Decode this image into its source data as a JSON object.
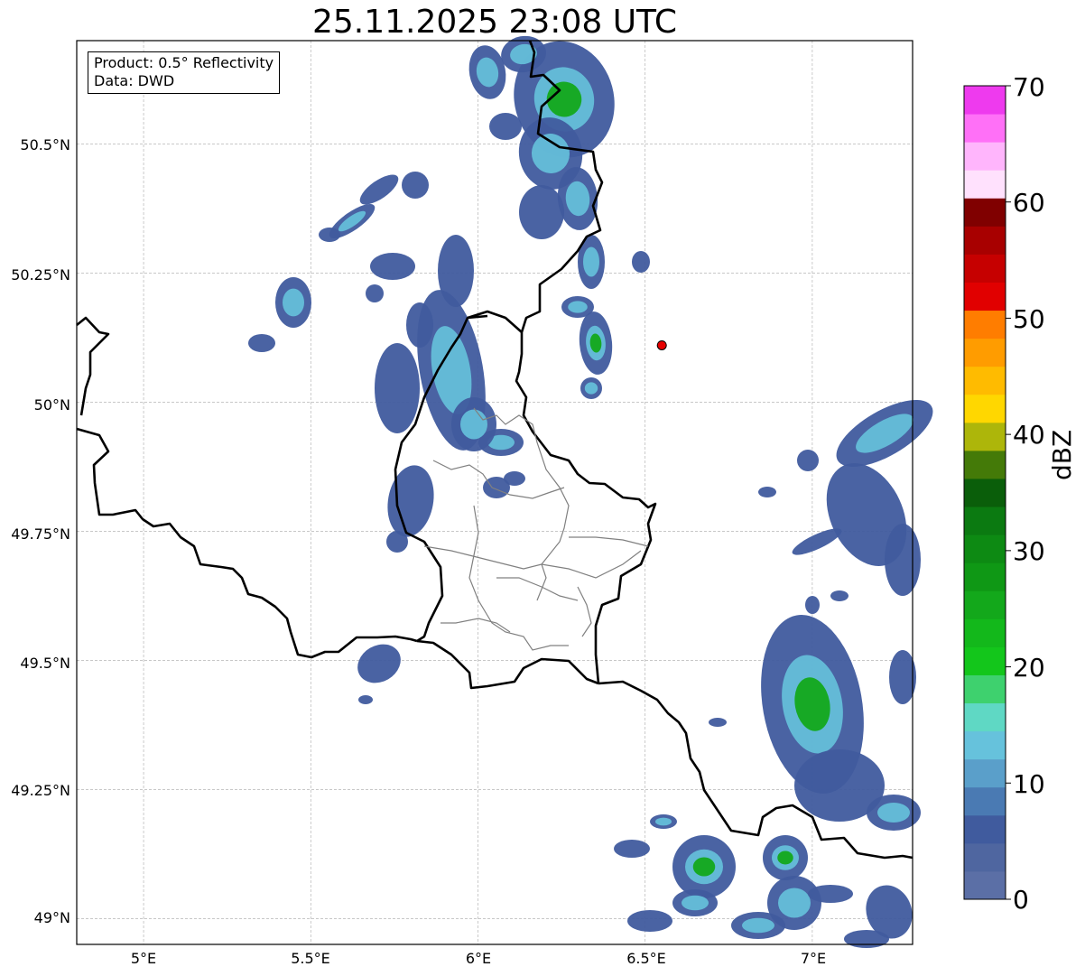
{
  "map": {
    "title": "25.11.2025 23:08 UTC",
    "info_box": {
      "product": "Product: 0.5° Reflectivity",
      "data": "Data: DWD"
    },
    "lat_labels": [
      "50.5°N",
      "50.25°N",
      "50°N",
      "49.75°N",
      "49.5°N",
      "49.25°N",
      "49°N"
    ],
    "lon_labels": [
      "5°E",
      "5.5°E",
      "6°E",
      "6.5°E",
      "7°E"
    ],
    "marker": {
      "lon": 6.55,
      "lat": 50.11,
      "color": "#e60000",
      "icon": "radar-site-dot"
    },
    "extent": {
      "lon_min": 4.8,
      "lon_max": 7.3,
      "lat_min": 48.95,
      "lat_max": 50.7
    },
    "grid": "dashed gray"
  },
  "colorbar": {
    "title": "dBZ",
    "tick_labels": [
      "0",
      "10",
      "20",
      "30",
      "40",
      "50",
      "60",
      "70"
    ],
    "colors": [
      "#5b6fa6",
      "#4f66a0",
      "#405b9e",
      "#4a7ab3",
      "#5a9fca",
      "#66c2dc",
      "#5fd8c4",
      "#3ed16e",
      "#13c61b",
      "#13b81b",
      "#13a81b",
      "#0f9815",
      "#0d8a13",
      "#0b7a11",
      "#0a5e0a",
      "#447a08",
      "#adb60a",
      "#ffd700",
      "#ffbb00",
      "#ff9c00",
      "#ff7d00",
      "#e10000",
      "#c60000",
      "#a80000",
      "#800000",
      "#ffe1fd",
      "#ffb5fc",
      "#ff70f7",
      "#ee3aee"
    ]
  }
}
